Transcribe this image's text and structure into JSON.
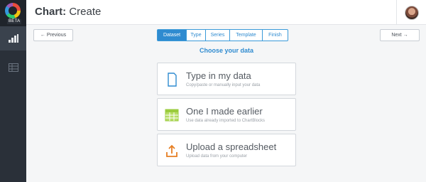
{
  "app": {
    "badge": "BETA"
  },
  "header": {
    "title_bold": "Chart:",
    "title_rest": "Create"
  },
  "nav": {
    "prev_label": "← Previous",
    "next_label": "Next →"
  },
  "wizard": {
    "tabs": [
      {
        "label": "Dataset",
        "active": true
      },
      {
        "label": "Type",
        "active": false
      },
      {
        "label": "Series",
        "active": false
      },
      {
        "label": "Template",
        "active": false
      },
      {
        "label": "Finish",
        "active": false
      }
    ],
    "heading": "Choose your data"
  },
  "options": [
    {
      "title": "Type in my data",
      "subtitle": "Copy/paste or manually input your data",
      "icon": "document-icon",
      "color": "#2f8bd0"
    },
    {
      "title": "One I made earlier",
      "subtitle": "Use data already imported to ChartBlocks",
      "icon": "table-icon",
      "color": "#9acb3c"
    },
    {
      "title": "Upload a spreadsheet",
      "subtitle": "Upload data from your computer",
      "icon": "upload-icon",
      "color": "#e67e22"
    }
  ],
  "sidebar": {
    "items": [
      {
        "icon": "bar-chart-icon",
        "active": true
      },
      {
        "icon": "table-icon",
        "active": false
      }
    ]
  },
  "colors": {
    "accent": "#2f8bd0",
    "sidebar": "#2a3039"
  }
}
